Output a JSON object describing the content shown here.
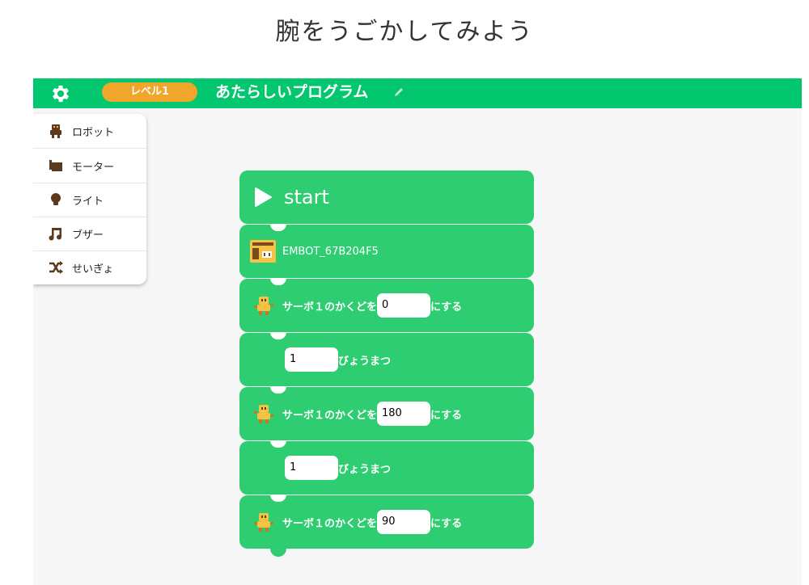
{
  "page": {
    "heading": "腕をうごかしてみよう"
  },
  "header": {
    "level_label": "レベル1",
    "program_title": "あたらしいプログラム",
    "bar_color": "#02c76e",
    "level_color": "#f0a52b"
  },
  "palette": {
    "items": [
      {
        "label": "ロボット",
        "icon": "robot-icon"
      },
      {
        "label": "モーター",
        "icon": "motor-icon"
      },
      {
        "label": "ライト",
        "icon": "light-bulb-icon"
      },
      {
        "label": "ブザー",
        "icon": "music-note-icon"
      },
      {
        "label": "せいぎょ",
        "icon": "shuffle-icon"
      }
    ]
  },
  "blocks": {
    "block_color": "#2ecd71",
    "start_label": "start",
    "embot_label": "EMBOT_67B204F5",
    "servo1": {
      "prefix": "サーボ１のかくどを",
      "value": "0",
      "suffix": "にする"
    },
    "wait1": {
      "value": "1",
      "suffix": "びょうまつ"
    },
    "servo2": {
      "prefix": "サーボ１のかくどを",
      "value": "180",
      "suffix": "にする"
    },
    "wait2": {
      "value": "1",
      "suffix": "びょうまつ"
    },
    "servo3": {
      "prefix": "サーボ１のかくどを",
      "value": "90",
      "suffix": "にする"
    }
  }
}
